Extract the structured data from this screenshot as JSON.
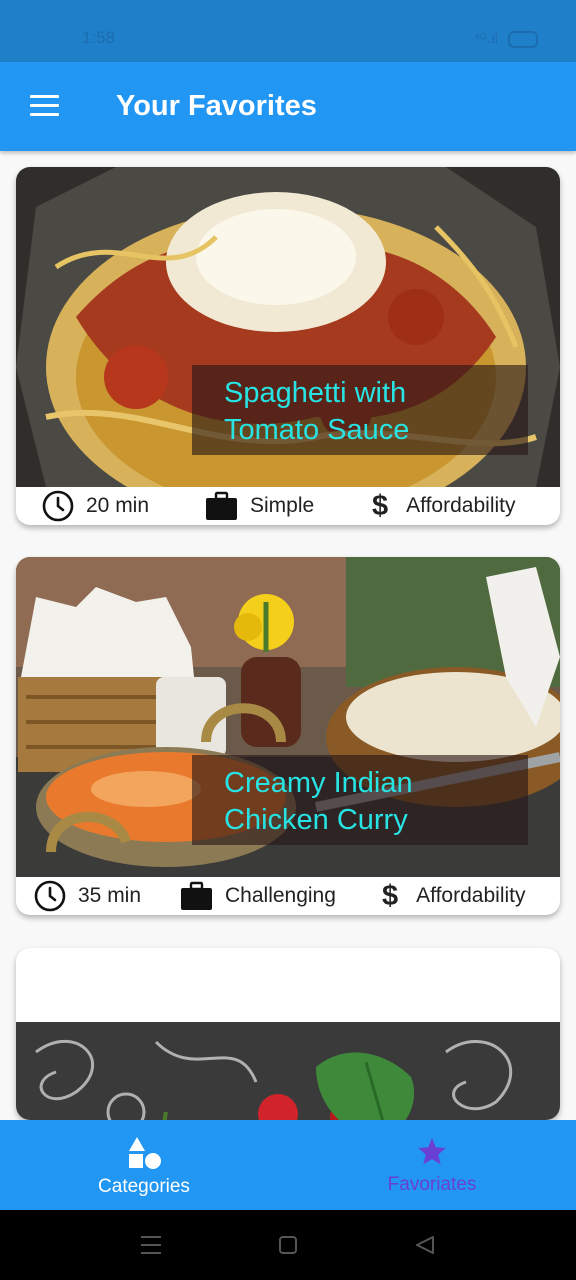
{
  "status_bar": {
    "time": "1:58",
    "signal": "⁴ᴳ.ıl"
  },
  "app_bar": {
    "title": "Your Favorites",
    "menu_icon": "menu-icon"
  },
  "meals": [
    {
      "title": "Spaghetti with Tomato Sauce",
      "title_line1": "Spaghetti with",
      "title_line2": "Tomato Sauce",
      "duration": "20 min",
      "complexity": "Simple",
      "affordability": "Affordability"
    },
    {
      "title": "Creamy Indian Chicken Curry",
      "title_line1": "Creamy Indian",
      "title_line2": "Chicken Curry",
      "duration": "35 min",
      "complexity": "Challenging",
      "affordability": "Affordability"
    }
  ],
  "bottom_nav": {
    "items": [
      {
        "label": "Categories",
        "icon": "category-shapes-icon",
        "color": "#ffffff"
      },
      {
        "label": "Favoriates",
        "icon": "star-icon",
        "color": "#6a3fd4"
      }
    ]
  },
  "colors": {
    "primary": "#2196f3",
    "caption_text": "#27e3e3",
    "active_tab": "#6a3fd4"
  }
}
